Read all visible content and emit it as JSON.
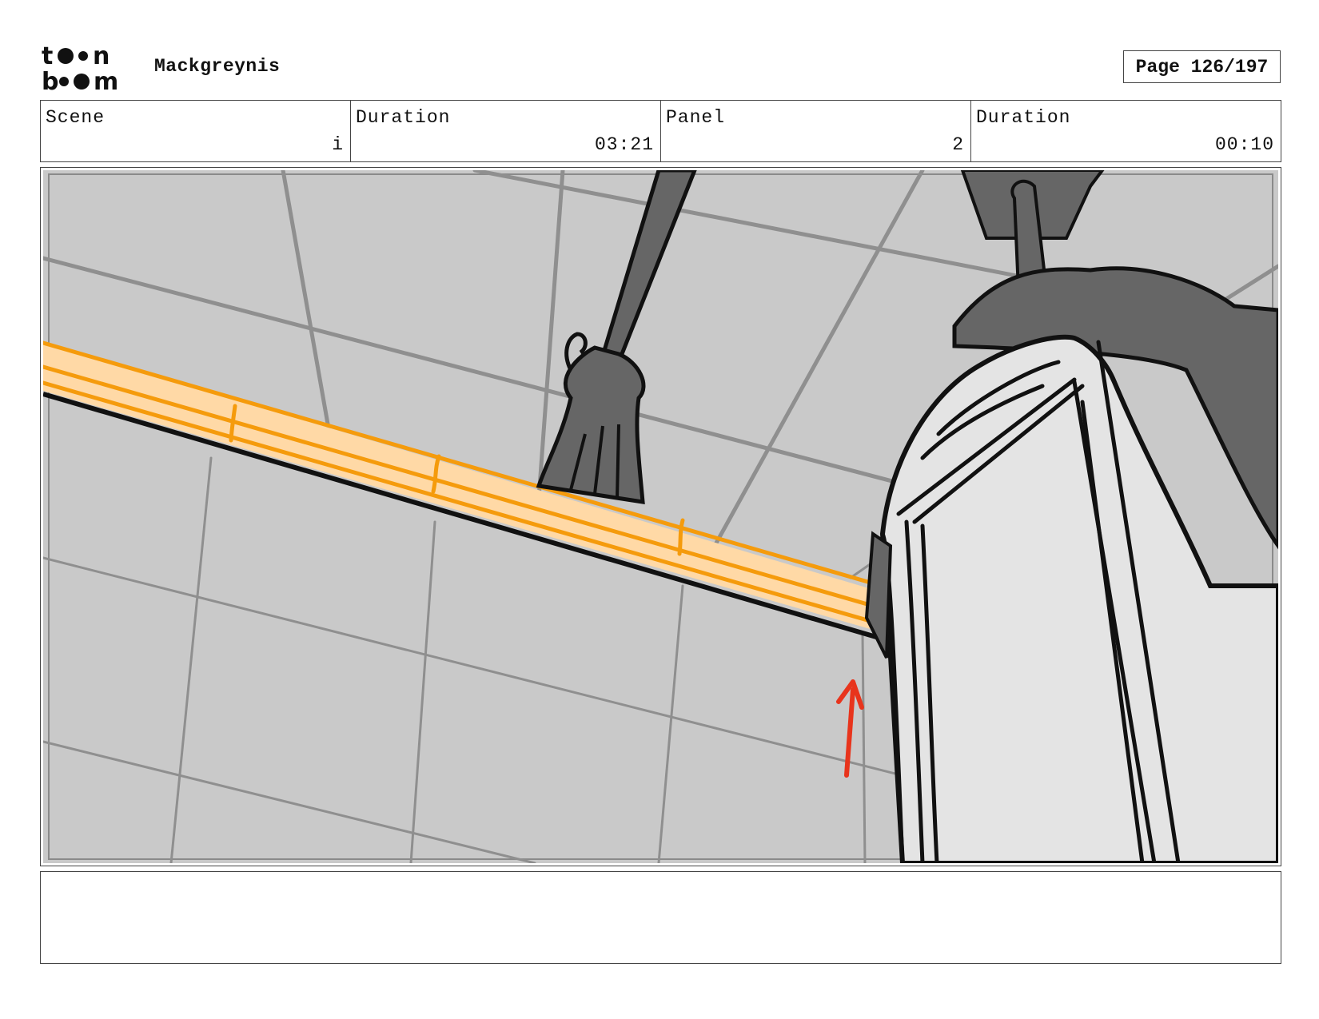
{
  "header": {
    "logo_text": "toon boom",
    "project_title": "Mackgreynis",
    "page_label": "Page 126/197"
  },
  "info": {
    "scene_label": "Scene",
    "scene_value": "i",
    "scene_duration_label": "Duration",
    "scene_duration_value": "03:21",
    "panel_label": "Panel",
    "panel_value": "2",
    "panel_duration_label": "Duration",
    "panel_duration_value": "00:10"
  },
  "panel": {
    "description": "",
    "colors": {
      "ceiling": "#c9c9c9",
      "tile_lines": "#8f8f8f",
      "light_strip": "#ffd9a6",
      "light_edge": "#f59b0c",
      "hanger": "#666666",
      "column": "#e4e4e4",
      "arrow": "#e8341c"
    }
  },
  "notes": {
    "text": ""
  }
}
